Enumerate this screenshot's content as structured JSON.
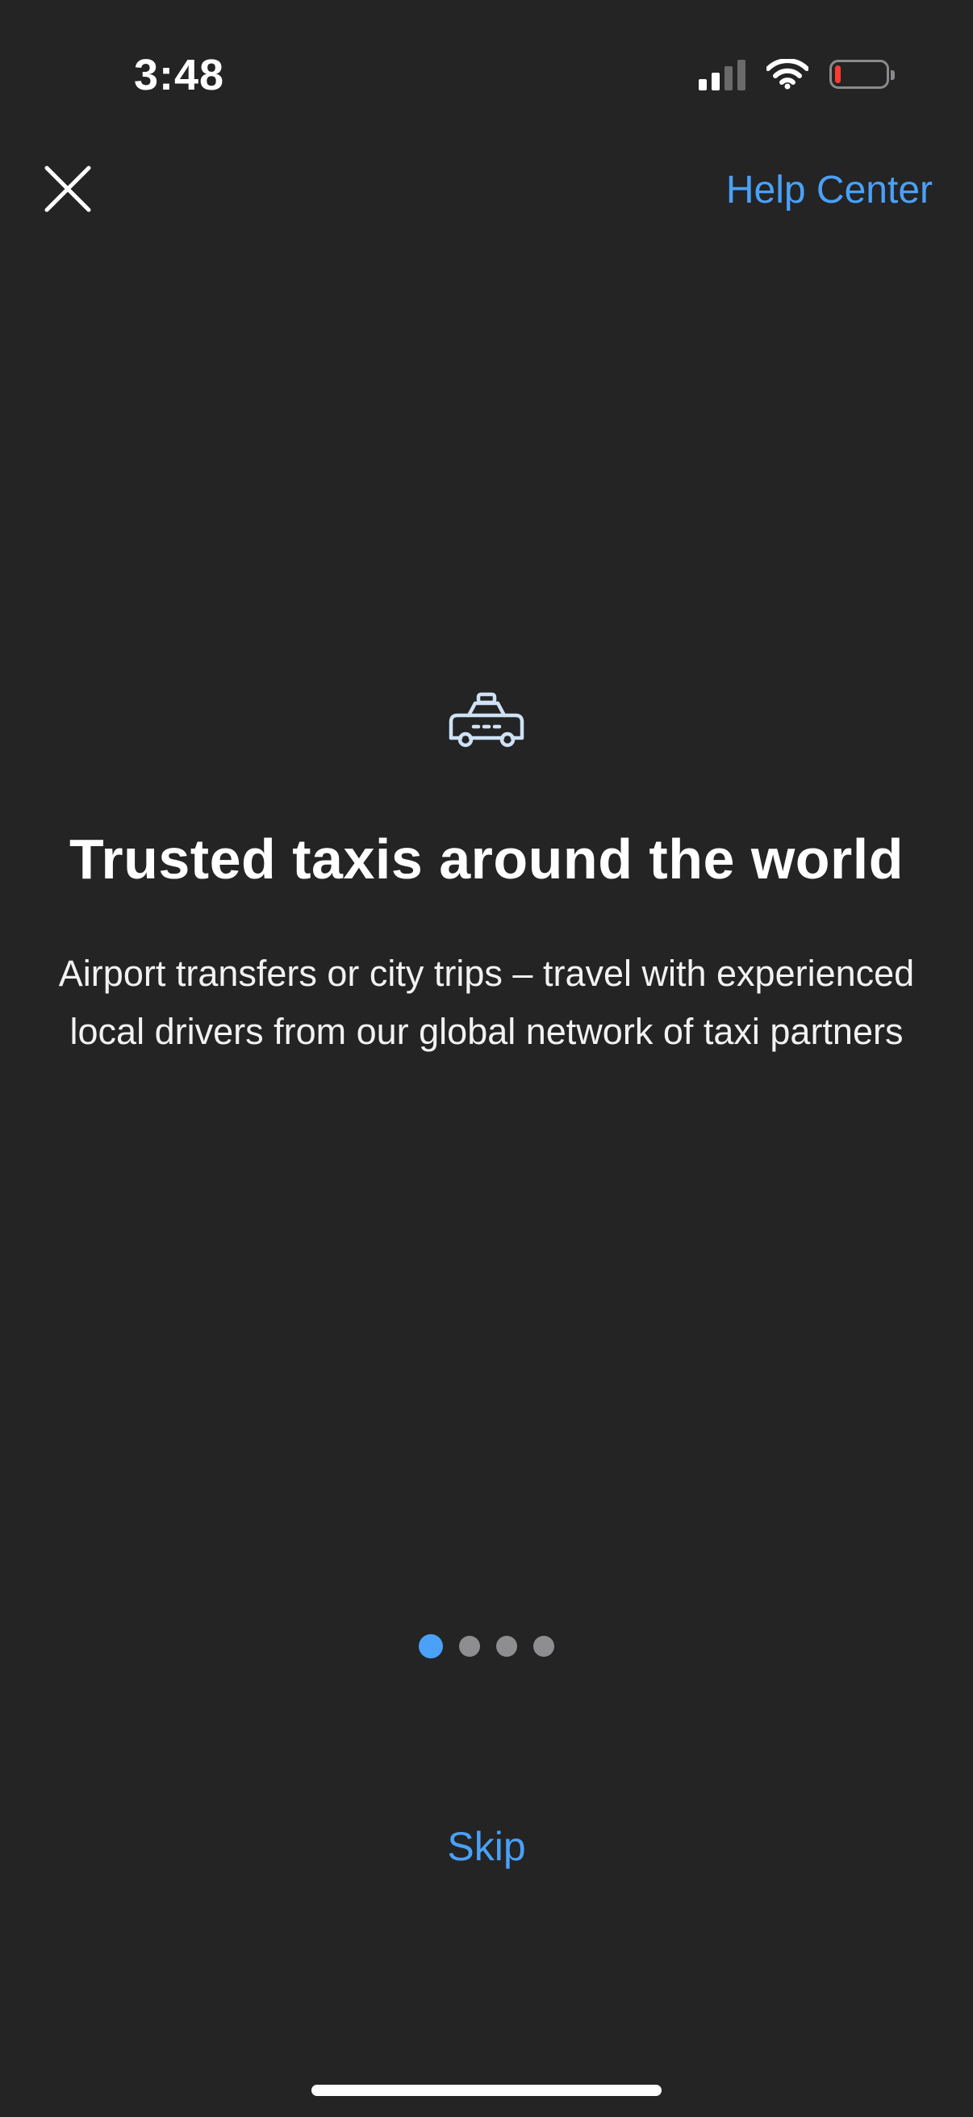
{
  "status_bar": {
    "time": "3:48",
    "battery_color": "#ff3b30",
    "battery_level": 0.12
  },
  "nav": {
    "close_icon": "close-icon",
    "help_label": "Help Center"
  },
  "content": {
    "icon": "taxi-icon",
    "title": "Trusted taxis around the world",
    "subtitle": "Airport transfers or city trips – travel with experienced local drivers from our global network of taxi partners"
  },
  "pager": {
    "page_count": 4,
    "active_index": 0,
    "active_color": "#4aa1f7",
    "inactive_color": "#8e8e90"
  },
  "actions": {
    "skip_label": "Skip"
  },
  "colors": {
    "accent": "#4aa1f7",
    "background": "#242425",
    "icon_stroke": "#cfe2f5"
  }
}
